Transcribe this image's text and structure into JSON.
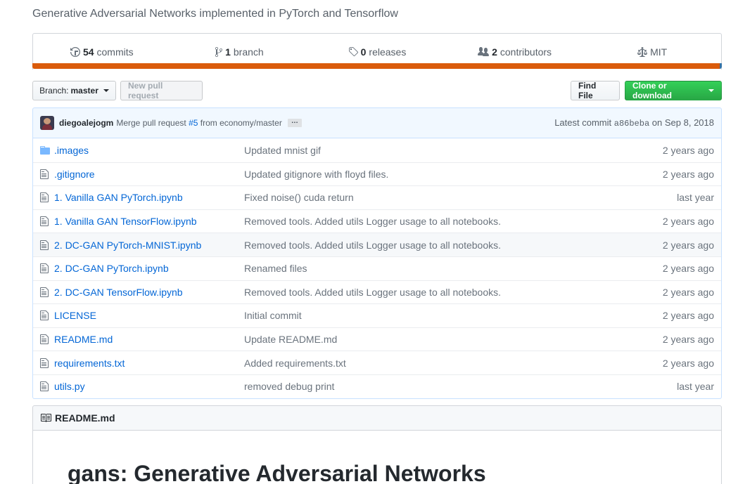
{
  "repo": {
    "description": "Generative Adversarial Networks implemented in PyTorch and Tensorflow"
  },
  "summary": {
    "commits": {
      "count": "54",
      "label": "commits",
      "icon": "history-icon"
    },
    "branches": {
      "count": "1",
      "label": "branch",
      "icon": "git-branch-icon"
    },
    "releases": {
      "count": "0",
      "label": "releases",
      "icon": "tag-icon"
    },
    "contributors": {
      "count": "2",
      "label": "contributors",
      "icon": "people-icon"
    },
    "license": {
      "label": "MIT",
      "icon": "law-icon"
    }
  },
  "language_bar": [
    {
      "color": "#DA5B0B",
      "percent": 99.7
    },
    {
      "color": "#3572A5",
      "percent": 0.3
    }
  ],
  "toolbar": {
    "branch_prefix": "Branch:",
    "branch_name": "master",
    "new_pr": "New pull request",
    "find_file": "Find File",
    "clone": "Clone or download"
  },
  "latest_commit": {
    "author": "diegoalejogm",
    "message_prefix": "Merge pull request",
    "pr_link": "#5",
    "message_suffix": "from economy/master",
    "ellipsis": "…",
    "latest_label": "Latest commit",
    "sha": "a86beba",
    "date": "on Sep 8, 2018"
  },
  "files": [
    {
      "type": "dir",
      "name": ".images",
      "message": "Updated mnist gif",
      "age": "2 years ago"
    },
    {
      "type": "file",
      "name": ".gitignore",
      "message": "Updated gitignore with floyd files.",
      "age": "2 years ago"
    },
    {
      "type": "file",
      "name": "1. Vanilla GAN PyTorch.ipynb",
      "message": "Fixed noise() cuda return",
      "age": "last year"
    },
    {
      "type": "file",
      "name": "1. Vanilla GAN TensorFlow.ipynb",
      "message": "Removed tools. Added utils Logger usage to all notebooks.",
      "age": "2 years ago"
    },
    {
      "type": "file",
      "name": "2. DC-GAN PyTorch-MNIST.ipynb",
      "message": "Removed tools. Added utils Logger usage to all notebooks.",
      "age": "2 years ago"
    },
    {
      "type": "file",
      "name": "2. DC-GAN PyTorch.ipynb",
      "message": "Renamed files",
      "age": "2 years ago"
    },
    {
      "type": "file",
      "name": "2. DC-GAN TensorFlow.ipynb",
      "message": "Removed tools. Added utils Logger usage to all notebooks.",
      "age": "2 years ago"
    },
    {
      "type": "file",
      "name": "LICENSE",
      "message": "Initial commit",
      "age": "2 years ago"
    },
    {
      "type": "file",
      "name": "README.md",
      "message": "Update README.md",
      "age": "2 years ago"
    },
    {
      "type": "file",
      "name": "requirements.txt",
      "message": "Added requirements.txt",
      "age": "2 years ago"
    },
    {
      "type": "file",
      "name": "utils.py",
      "message": "removed debug print",
      "age": "last year"
    }
  ],
  "readme": {
    "filename": "README.md",
    "icon": "book-icon",
    "title": "gans: Generative Adversarial Networks"
  }
}
